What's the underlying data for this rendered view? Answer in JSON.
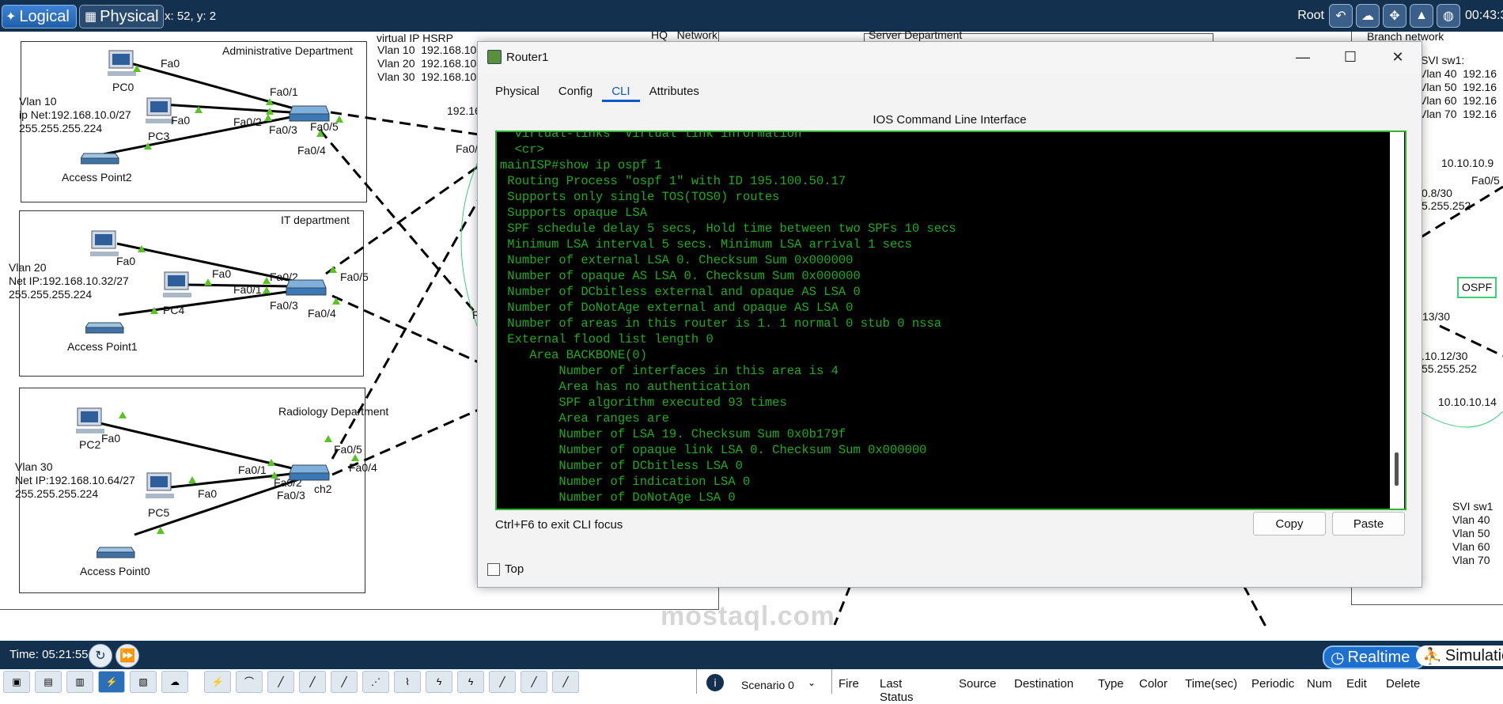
{
  "topbar": {
    "logical_label": "Logical",
    "physical_label": "Physical",
    "coords": "x: 52, y: 2",
    "user": "Root",
    "clock": "00:43:3"
  },
  "canvas": {
    "admin_title": "Administrative Department",
    "it_title": "IT department",
    "radiology_title": "Radiology Department",
    "hsrp_title": "virtual IP HSRP",
    "hsrp_lines": [
      "Vlan 10  192.168.10",
      "Vlan 20  192.168.10",
      "Vlan 30  192.168.10"
    ],
    "hq_network": "HQ   Network",
    "server_dept": "Server Department",
    "branch_network": "Branch network",
    "vlan10": "Vlan 10\nip Net:192.168.10.0/27\n255.255.255.224",
    "vlan20": "Vlan 20\nNet IP:192.168.10.32/27\n255.255.255.224",
    "vlan30": "Vlan 30\nNet IP:192.168.10.64/27\n255.255.255.224",
    "pc0": "PC0",
    "pc3": "PC3",
    "pc4": "PC4",
    "pc2": "PC2",
    "pc5": "PC5",
    "ap2": "Access Point2",
    "ap1": "Access Point1",
    "ap0": "Access Point0",
    "switch2_label": "ch2",
    "ports": {
      "a_fa0_pc0": "Fa0",
      "a_fa01": "Fa0/1",
      "a_fa0_pc3": "Fa0",
      "a_fa02": "Fa0/2",
      "a_fa03": "Fa0/3",
      "a_fa05": "Fa0/5",
      "a_fa04": "Fa0/4",
      "a_fa0_r": "Fa0/",
      "i_fa0_pc": "Fa0",
      "i_fa0_b": "Fa0",
      "i_fa02": "Fa0/2",
      "i_fa01": "Fa0/1",
      "i_fa03": "Fa0/3",
      "i_fa05": "Fa0/5",
      "i_fa04": "Fa0/4",
      "r_fa0_pc2": "Fa0",
      "r_fa01": "Fa0/1",
      "r_fa02": "Fa0/2",
      "r_fa03": "Fa0/3",
      "r_fa0_pc5": "Fa0",
      "r_fa05": "Fa0/5",
      "r_fa04": "Fa0/4"
    },
    "ip_192": "192.16",
    "svi_sw1_title": "SVI sw1:",
    "svi_sw1_lines": [
      "Vlan 40  192.16",
      "Vlan 50  192.16",
      "Vlan 60  192.16",
      "Vlan 70  192.16"
    ],
    "r_10_9": "10.10.10.9",
    "r_fa0_5": "Fa0/5",
    "r_08_30": "0.8/30",
    "r_mask1": "5.255.252",
    "ospf_label": "OSPF",
    "r_13_30": "13/30",
    "r_12_30": ".10.12/30",
    "r_mask2": "55.255.252",
    "r_10_14": "10.10.10.14",
    "svi_sw1_b_title": "SVI sw1",
    "svi_sw1_b_lines": [
      "Vlan 40",
      "Vlan 50",
      "Vlan 60",
      "Vlan 70"
    ],
    "letter_f": "F"
  },
  "window": {
    "title": "Router1",
    "tabs": [
      "Physical",
      "Config",
      "CLI",
      "Attributes"
    ],
    "active_tab": "CLI",
    "cli_header": "IOS Command Line Interface",
    "terminal_lines": [
      "  virtual-links  Virtual link information",
      "  <cr>",
      "mainISP#show ip ospf 1",
      " Routing Process \"ospf 1\" with ID 195.100.50.17",
      " Supports only single TOS(TOS0) routes",
      " Supports opaque LSA",
      " SPF schedule delay 5 secs, Hold time between two SPFs 10 secs",
      " Minimum LSA interval 5 secs. Minimum LSA arrival 1 secs",
      " Number of external LSA 0. Checksum Sum 0x000000",
      " Number of opaque AS LSA 0. Checksum Sum 0x000000",
      " Number of DCbitless external and opaque AS LSA 0",
      " Number of DoNotAge external and opaque AS LSA 0",
      " Number of areas in this router is 1. 1 normal 0 stub 0 nssa",
      " External flood list length 0",
      "    Area BACKBONE(0)",
      "        Number of interfaces in this area is 4",
      "        Area has no authentication",
      "        SPF algorithm executed 93 times",
      "        Area ranges are",
      "        Number of LSA 19. Checksum Sum 0x0b179f",
      "        Number of opaque link LSA 0. Checksum Sum 0x000000",
      "        Number of DCbitless LSA 0",
      "        Number of indication LSA 0",
      "        Number of DoNotAge LSA 0"
    ],
    "hint": "Ctrl+F6 to exit CLI focus",
    "copy": "Copy",
    "paste": "Paste",
    "top_label": "Top"
  },
  "bottom": {
    "time": "Time: 05:21:55",
    "realtime": "Realtime",
    "simulation": "Simulation",
    "scenario": "Scenario 0",
    "pdu_columns": [
      "Fire",
      "Last Status",
      "Source",
      "Destination",
      "Type",
      "Color",
      "Time(sec)",
      "Periodic",
      "Num",
      "Edit",
      "Delete"
    ]
  },
  "watermark": "mostaql.com",
  "colors": {
    "topbar": "#13304f",
    "terminal_text": "#1aad1a",
    "terminal_border": "#2fb52f",
    "active_tab": "#0a58ca",
    "port_up": "#58c322"
  }
}
